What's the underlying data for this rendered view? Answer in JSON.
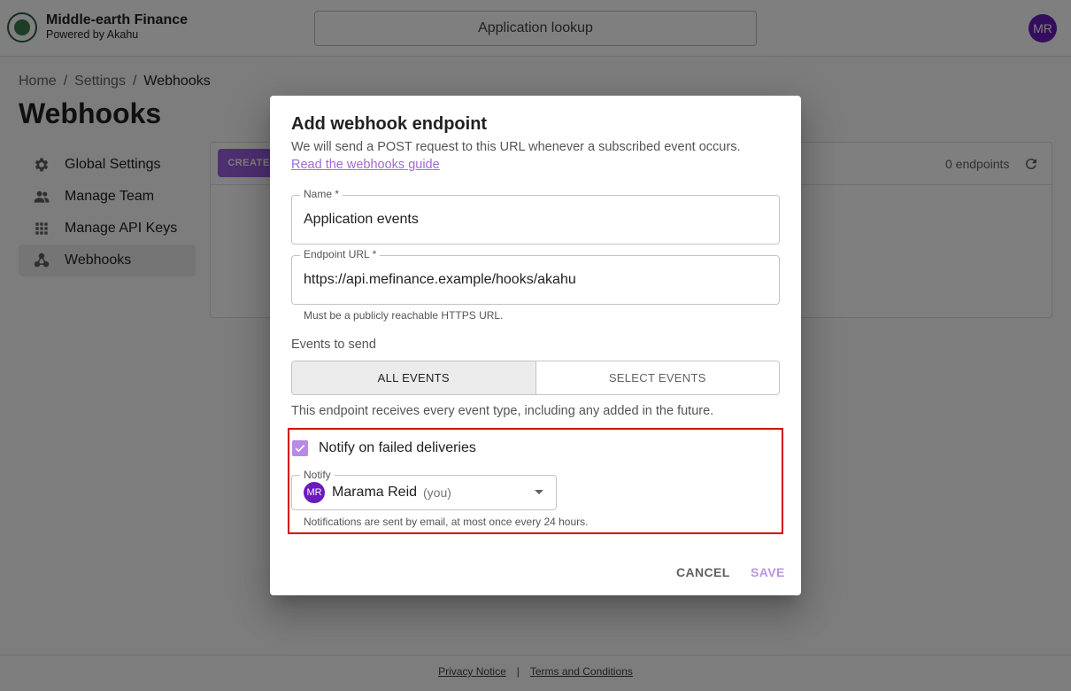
{
  "header": {
    "brand_title": "Middle-earth Finance",
    "brand_subtitle": "Powered by Akahu",
    "lookup_label": "Application lookup",
    "user_initials": "MR"
  },
  "breadcrumb": {
    "home": "Home",
    "sep1": "/",
    "settings": "Settings",
    "sep2": "/",
    "current": "Webhooks"
  },
  "page_title": "Webhooks",
  "sidebar": {
    "items": [
      {
        "label": "Global Settings",
        "icon": "gear-icon"
      },
      {
        "label": "Manage Team",
        "icon": "people-icon"
      },
      {
        "label": "Manage API Keys",
        "icon": "grid-icon"
      },
      {
        "label": "Webhooks",
        "icon": "webhook-icon",
        "active": true
      }
    ]
  },
  "panel": {
    "create_label": "CREATE",
    "endpoints_count": "0 endpoints"
  },
  "dialog": {
    "title": "Add webhook endpoint",
    "description": "We will send a POST request to this URL whenever a subscribed event occurs.",
    "guide_link": "Read the webhooks guide",
    "name_label": "Name *",
    "name_value": "Application events",
    "url_label": "Endpoint URL *",
    "url_value": "https://api.mefinance.example/hooks/akahu",
    "url_helper": "Must be a publicly reachable HTTPS URL.",
    "events_label": "Events to send",
    "toggle_all": "ALL EVENTS",
    "toggle_select": "SELECT EVENTS",
    "events_desc": "This endpoint receives every event type, including any added in the future.",
    "notify_checkbox_label": "Notify on failed deliveries",
    "notify_checked": true,
    "notify_label": "Notify",
    "notify_initials": "MR",
    "notify_name": "Marama Reid",
    "notify_you": "(you)",
    "notify_helper": "Notifications are sent by email, at most once every 24 hours.",
    "cancel_label": "CANCEL",
    "save_label": "SAVE"
  },
  "footer": {
    "privacy": "Privacy Notice",
    "sep": "|",
    "terms": "Terms and Conditions"
  },
  "colors": {
    "accent": "#9c5fe0",
    "avatar": "#6a1bbd",
    "highlight": "#d60000"
  }
}
